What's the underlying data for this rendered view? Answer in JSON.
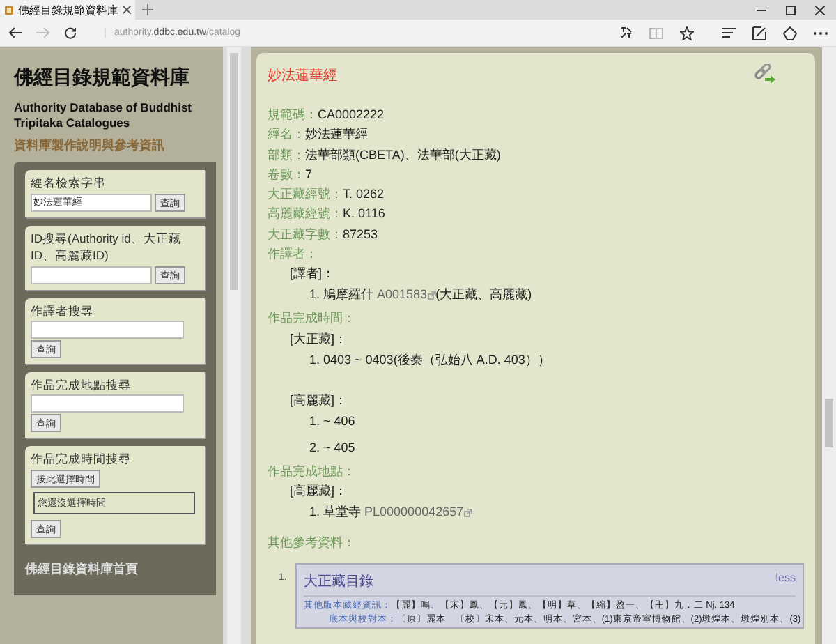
{
  "browser": {
    "tab_title": "佛經目錄規範資料庫",
    "url": {
      "prefix": "authority.",
      "domain": "ddbc.edu.tw",
      "path": "/catalog"
    },
    "forward_disabled": true
  },
  "sidebar": {
    "title": "佛經目錄規範資料庫",
    "subtitle": "Authority Database of Buddhist Tripitaka Catalogues",
    "link": "資料庫製作說明與參考資訊",
    "search_boxes": [
      {
        "kind": "inline",
        "label": "經名檢索字串",
        "value": "妙法蓮華經",
        "button": "查詢"
      },
      {
        "kind": "inline",
        "label": "ID搜尋(Authority id、大正藏ID、高麗藏ID)",
        "button": "查詢"
      },
      {
        "kind": "stacked",
        "label": "作譯者搜尋",
        "button": "查詢"
      },
      {
        "kind": "stacked",
        "label": "作品完成地點搜尋",
        "button": "查詢"
      },
      {
        "kind": "time",
        "label": "作品完成時間搜尋",
        "pick_button": "按此選擇時間",
        "display": "您還沒選擇時間",
        "button": "查詢"
      }
    ],
    "footer_link": "佛經目錄資料庫首頁"
  },
  "record": {
    "title": "妙法蓮華經",
    "fields": [
      {
        "label": "規範碼：",
        "value": "CA0002222"
      },
      {
        "label": "經名：",
        "value": "妙法蓮華經"
      },
      {
        "label": "部類：",
        "value": "法華部類(CBETA)、法華部(大正藏)"
      },
      {
        "label": "卷數：",
        "value": "7"
      },
      {
        "label": "大正藏經號：",
        "value": "T. 0262"
      },
      {
        "label": "高麗藏經號：",
        "value": "K. 0116"
      },
      {
        "label": "大正藏字數：",
        "value": "87253"
      }
    ],
    "sections": [
      {
        "label": "作譯者：",
        "groups": [
          {
            "heading": "[譯者]：",
            "items": [
              {
                "number": "1.",
                "text": "鳩摩羅什",
                "code": "A001583",
                "note": "(大正藏、高麗藏)"
              }
            ]
          }
        ]
      },
      {
        "label": "作品完成時間：",
        "groups": [
          {
            "heading": "[大正藏]：",
            "items": [
              {
                "number": "1.",
                "text": "0403 ~ 0403(後秦（弘始八 A.D. 403））"
              }
            ]
          },
          {
            "heading": "[高麗藏]：",
            "items": [
              {
                "number": "1.",
                "text": "~ 406"
              },
              {
                "number": "2.",
                "text": "~ 405"
              }
            ]
          }
        ]
      },
      {
        "label": "作品完成地點：",
        "groups": [
          {
            "heading": "[高麗藏]：",
            "items": [
              {
                "number": "1.",
                "text": "草堂寺",
                "code": "PL000000042657"
              }
            ]
          }
        ]
      }
    ],
    "references_label": "其他參考資料：",
    "references": [
      {
        "number": "1.",
        "title": "大正藏目錄",
        "toggle": "less",
        "lines": [
          {
            "label": "其他版本藏經資訊：",
            "value": "【麗】鳴、【宋】鳳、【元】鳳、【明】草、【縮】盈一、【卍】九．二 Nj. 134"
          },
          {
            "label": "底本與校對本：",
            "value": "〔原〕麗本　〔校〕宋本、元本、明本、宮本、(1)東京帝室博物館、(2)燉煌本、燉煌別本、(3)"
          }
        ]
      }
    ]
  }
}
